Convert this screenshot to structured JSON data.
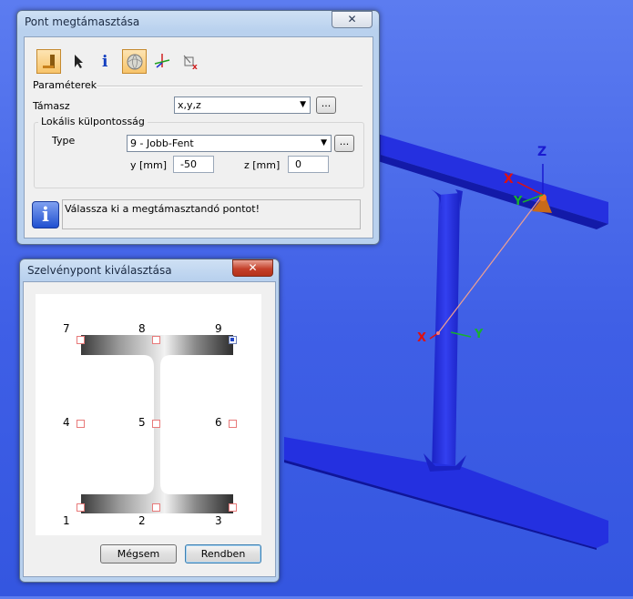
{
  "dialog1": {
    "title": "Pont megtámasztása",
    "close": "✕",
    "section_parameters": "Paraméterek",
    "support_label": "Támasz",
    "support_value": "x,y,z",
    "browse": "...",
    "group_title": "Lokális külpontosság",
    "type_label": "Type",
    "type_value": "9 - Jobb-Fent",
    "y_label": "y [mm]",
    "y_value": "-50",
    "z_label": "z [mm]",
    "z_value": "0",
    "message": "Válassza ki a megtámasztandó pontot!"
  },
  "dialog2": {
    "title": "Szelvénypont kiválasztása",
    "close": "✕",
    "points": [
      "1",
      "2",
      "3",
      "4",
      "5",
      "6",
      "7",
      "8",
      "9"
    ],
    "selected": "9",
    "cancel": "Mégsem",
    "ok": "Rendben"
  },
  "viewport": {
    "axis_z": "Z",
    "axis_x": "X",
    "axis_y": "Y",
    "axis_x2": "X",
    "axis_y2": "Y",
    "beam_color": "#1a1fd8",
    "background_color": "#4a6ae8"
  }
}
